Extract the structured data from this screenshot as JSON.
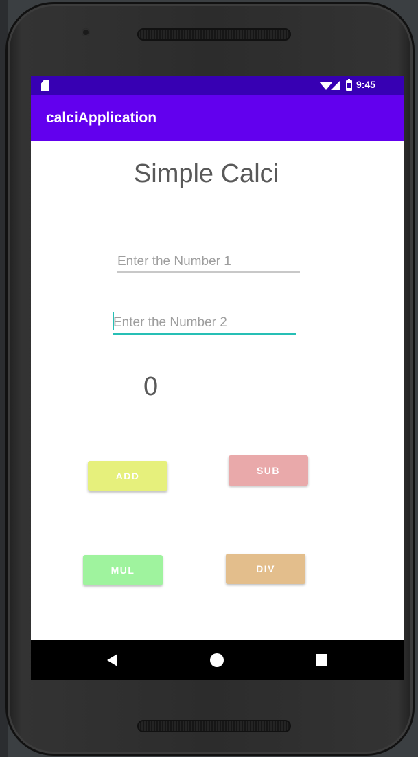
{
  "status_bar": {
    "time": "9:45",
    "icons": [
      "sd-card-icon",
      "wifi-icon",
      "signal-icon",
      "battery-icon"
    ]
  },
  "app_bar": {
    "title": "calciApplication",
    "color": "#6200ee"
  },
  "main": {
    "heading": "Simple Calci",
    "number1": {
      "value": "",
      "placeholder": "Enter the Number 1"
    },
    "number2": {
      "value": "",
      "placeholder": "Enter the Number 2"
    },
    "result": "0",
    "buttons": {
      "add": {
        "label": "ADD",
        "color": "#e6f07c"
      },
      "sub": {
        "label": "SUB",
        "color": "#e9a9aa"
      },
      "mul": {
        "label": "MUL",
        "color": "#9ff39e"
      },
      "div": {
        "label": "DIV",
        "color": "#e3be8c"
      }
    }
  },
  "nav_bar": {
    "icons": [
      "back-icon",
      "home-icon",
      "recents-icon"
    ]
  },
  "colors": {
    "status_bar": "#3700b3",
    "accent": "#26bfb5"
  }
}
